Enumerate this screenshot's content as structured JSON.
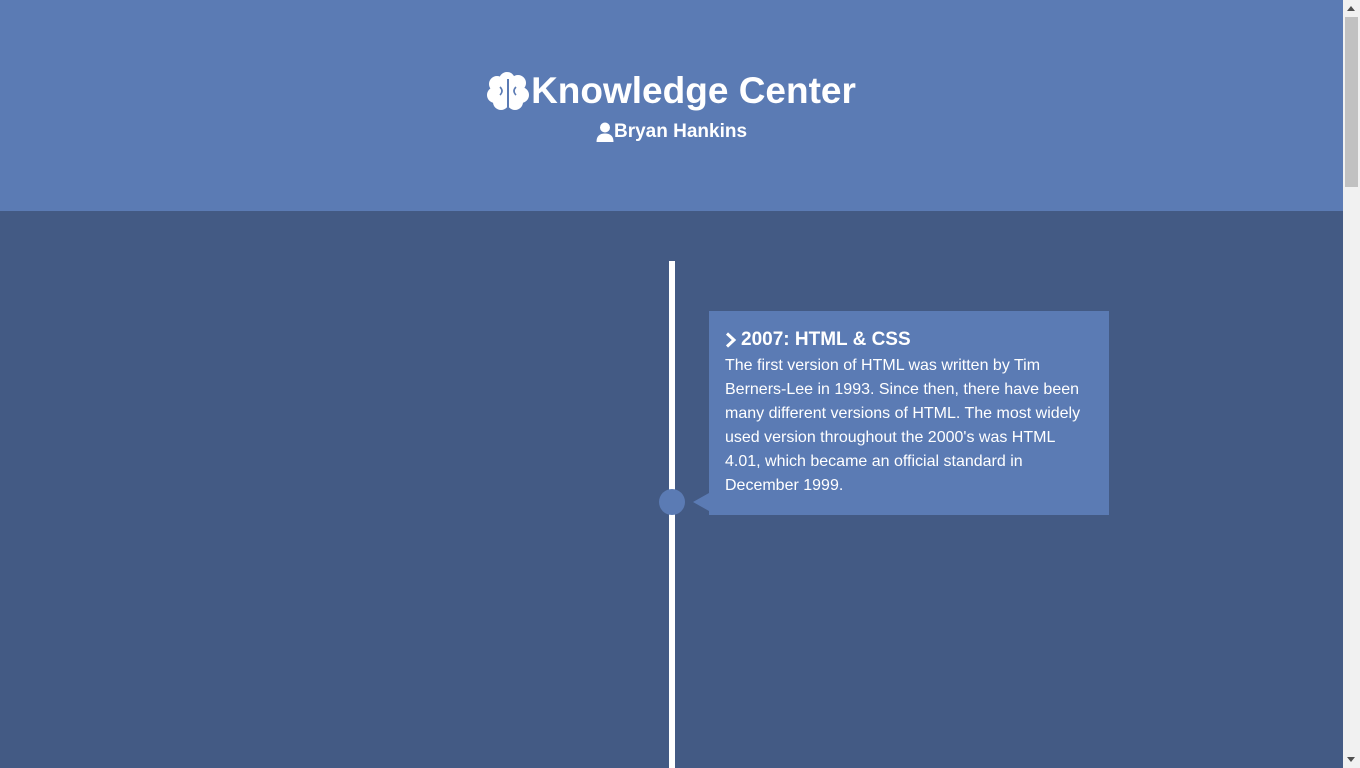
{
  "header": {
    "title": "Knowledge Center",
    "title_icon": "brain-icon",
    "user_icon": "user-icon",
    "user_name": "Bryan Hankins"
  },
  "timeline": {
    "entries": [
      {
        "icon": "chevron-right-icon",
        "title": "2007: HTML & CSS",
        "body": "The first version of HTML was written by Tim Berners-Lee in 1993. Since then, there have been many different versions of HTML. The most widely used version throughout the 2000's was HTML 4.01, which became an official standard in December 1999."
      }
    ]
  },
  "colors": {
    "header_bg": "#5b7bb4",
    "main_bg": "#435a84",
    "card_bg": "#5b7bb4",
    "line": "#ffffff",
    "text": "#ffffff"
  }
}
